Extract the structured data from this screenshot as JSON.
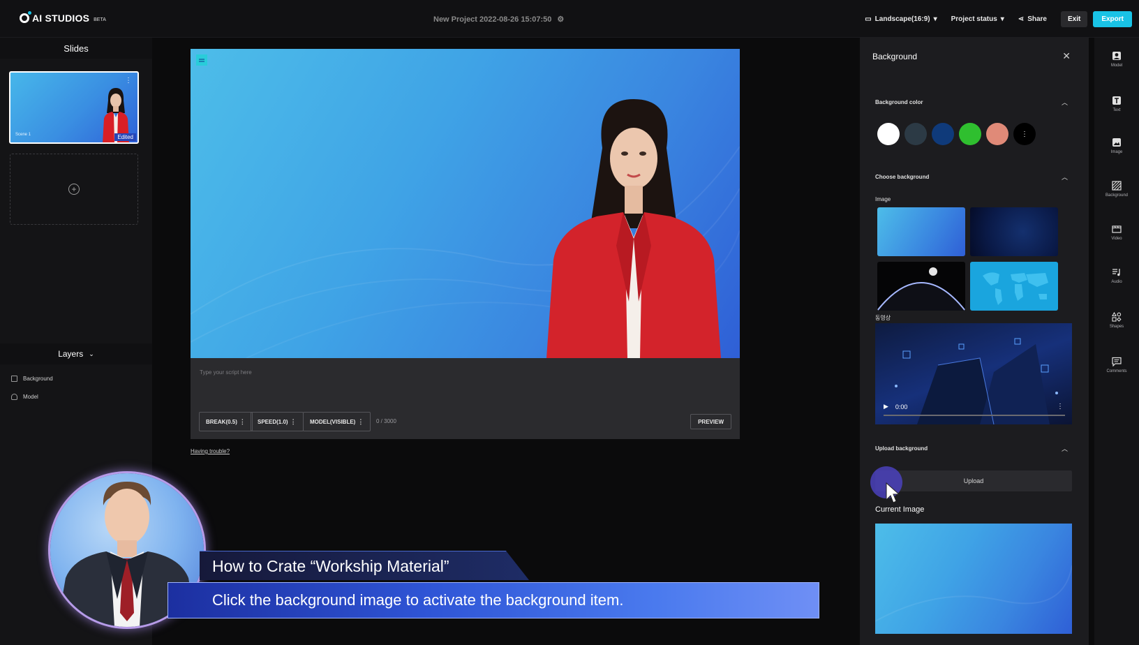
{
  "app": {
    "logo_text": "AI STUDIOS",
    "logo_beta": "BETA",
    "project_title": "New Project 2022-08-26 15:07:50"
  },
  "topbar": {
    "orientation": "Landscape(16:9)",
    "project_status": "Project status",
    "share": "Share",
    "exit": "Exit",
    "export": "Export"
  },
  "slides": {
    "header": "Slides",
    "items": [
      {
        "scene_label": "Scene 1",
        "edited_badge": "Edited"
      }
    ]
  },
  "layers": {
    "header": "Layers",
    "items": [
      {
        "label": "Background",
        "icon": "image-icon"
      },
      {
        "label": "Model",
        "icon": "person-icon"
      }
    ]
  },
  "editor": {
    "script_placeholder": "Type your script here",
    "break_label": "BREAK(0.5)",
    "speed_label": "SPEED(1.0)",
    "model_label": "MODEL(VISIBLE)",
    "char_count": "0 / 3000",
    "preview": "PREVIEW",
    "having_trouble": "Having trouble?"
  },
  "overlay": {
    "title": "How to Crate “Workship Material”",
    "subtitle": "Click the background image to activate the background item."
  },
  "background_panel": {
    "title": "Background",
    "bg_color_section": "Background color",
    "colors": [
      "#ffffff",
      "#2c3a45",
      "#0f3a7a",
      "#2fbf2f",
      "#e08a78"
    ],
    "choose_section": "Choose background",
    "image_label": "Image",
    "video_label": "동영상",
    "video_time": "0:00",
    "upload_section": "Upload background",
    "upload_button": "Upload",
    "current_image_label": "Current Image"
  },
  "toolbar": {
    "items": [
      {
        "label": "Model",
        "icon": "model-icon"
      },
      {
        "label": "Text",
        "icon": "text-icon"
      },
      {
        "label": "Image",
        "icon": "image-icon"
      },
      {
        "label": "Background",
        "icon": "background-icon"
      },
      {
        "label": "Video",
        "icon": "video-icon"
      },
      {
        "label": "Audio",
        "icon": "audio-icon"
      },
      {
        "label": "Shapes",
        "icon": "shapes-icon"
      },
      {
        "label": "Comments",
        "icon": "comments-icon"
      }
    ]
  },
  "colors": {
    "accent": "#19c3e6",
    "canvas_bg_start": "#4dbde9",
    "canvas_bg_end": "#2f5fd6"
  }
}
